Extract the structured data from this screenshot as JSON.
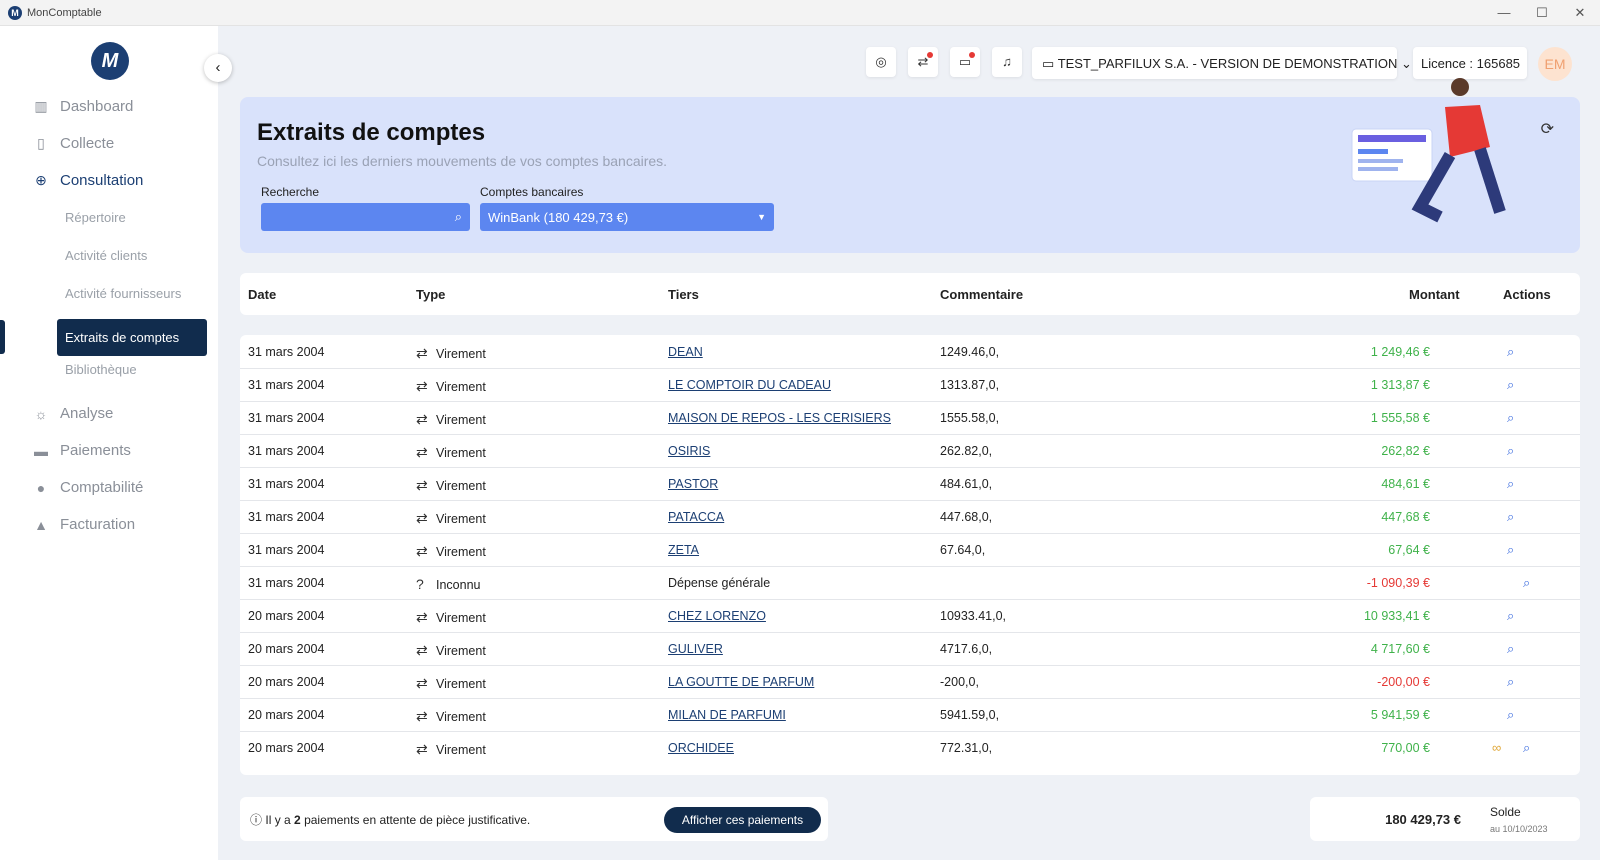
{
  "window": {
    "title": "MonComptable",
    "logo_letter": "M",
    "min": "—",
    "max": "☐",
    "close": "✕"
  },
  "sidebar": {
    "logo": "M",
    "collapse_icon": "‹",
    "items": [
      {
        "label": "Dashboard",
        "icon": "chart-icon"
      },
      {
        "label": "Collecte",
        "icon": "file-icon"
      },
      {
        "label": "Consultation",
        "icon": "search-zoom-icon"
      },
      {
        "label": "Analyse",
        "icon": "bulb-icon"
      },
      {
        "label": "Paiements",
        "icon": "card-icon"
      },
      {
        "label": "Comptabilité",
        "icon": "user-icon"
      },
      {
        "label": "Facturation",
        "icon": "bag-icon"
      }
    ],
    "sub_items": [
      "Répertoire",
      "Activité clients",
      "Activité fournisseurs",
      "Extraits de comptes",
      "Bibliothèque"
    ]
  },
  "topbar": {
    "company": "TEST_PARFILUX S.A. - VERSION DE DEMONSTRATION",
    "licence": "Licence : 165685",
    "avatar": "EM"
  },
  "banner": {
    "title": "Extraits de comptes",
    "subtitle": "Consultez ici les derniers mouvements de vos comptes bancaires.",
    "search_label": "Recherche",
    "search_value": "",
    "accounts_label": "Comptes bancaires",
    "account_selected": "WinBank (180 429,73 €)"
  },
  "table": {
    "headers": {
      "date": "Date",
      "type": "Type",
      "tiers": "Tiers",
      "comment": "Commentaire",
      "amount": "Montant",
      "actions": "Actions"
    },
    "rows": [
      {
        "date": "31 mars 2004",
        "type": "Virement",
        "tiers": "DEAN",
        "comment": "1249.46,0,",
        "amount": "1 249,46 €",
        "sign": "pos"
      },
      {
        "date": "31 mars 2004",
        "type": "Virement",
        "tiers": "LE COMPTOIR DU CADEAU",
        "comment": "1313.87,0,",
        "amount": "1 313,87 €",
        "sign": "pos"
      },
      {
        "date": "31 mars 2004",
        "type": "Virement",
        "tiers": "MAISON DE REPOS - LES CERISIERS",
        "comment": "1555.58,0,",
        "amount": "1 555,58 €",
        "sign": "pos"
      },
      {
        "date": "31 mars 2004",
        "type": "Virement",
        "tiers": "OSIRIS",
        "comment": "262.82,0,",
        "amount": "262,82 €",
        "sign": "pos"
      },
      {
        "date": "31 mars 2004",
        "type": "Virement",
        "tiers": "PASTOR",
        "comment": "484.61,0,",
        "amount": "484,61 €",
        "sign": "pos"
      },
      {
        "date": "31 mars 2004",
        "type": "Virement",
        "tiers": "PATACCA",
        "comment": "447.68,0,",
        "amount": "447,68 €",
        "sign": "pos"
      },
      {
        "date": "31 mars 2004",
        "type": "Virement",
        "tiers": "ZETA",
        "comment": "67.64,0,",
        "amount": "67,64 €",
        "sign": "pos"
      },
      {
        "date": "31 mars 2004",
        "type": "Inconnu",
        "tiers": "Dépense générale",
        "comment": "",
        "amount": "-1 090,39 €",
        "sign": "neg"
      },
      {
        "date": "20 mars 2004",
        "type": "Virement",
        "tiers": "CHEZ LORENZO",
        "comment": "10933.41,0,",
        "amount": "10 933,41 €",
        "sign": "pos"
      },
      {
        "date": "20 mars 2004",
        "type": "Virement",
        "tiers": "GULIVER",
        "comment": "4717.6,0,",
        "amount": "4 717,60 €",
        "sign": "pos"
      },
      {
        "date": "20 mars 2004",
        "type": "Virement",
        "tiers": "LA GOUTTE DE PARFUM",
        "comment": "-200,0,",
        "amount": "-200,00 €",
        "sign": "neg"
      },
      {
        "date": "20 mars 2004",
        "type": "Virement",
        "tiers": "MILAN DE PARFUMI",
        "comment": "5941.59,0,",
        "amount": "5 941,59 €",
        "sign": "pos"
      },
      {
        "date": "20 mars 2004",
        "type": "Virement",
        "tiers": "ORCHIDEE",
        "comment": "772.31,0,",
        "amount": "770,00 €",
        "sign": "pos"
      }
    ]
  },
  "footer": {
    "info_pre": "Il y a",
    "info_count": "2",
    "info_post": "paiements en attente de pièce justificative.",
    "button": "Afficher ces paiements",
    "balance": "180 429,73 €",
    "balance_label": "Solde",
    "balance_date": "au 10/10/2023"
  },
  "colors": {
    "primary": "#112c4d",
    "accent": "#5c86f0",
    "banner": "#d9e2fb",
    "positive": "#3fb24a",
    "negative": "#e53935"
  }
}
